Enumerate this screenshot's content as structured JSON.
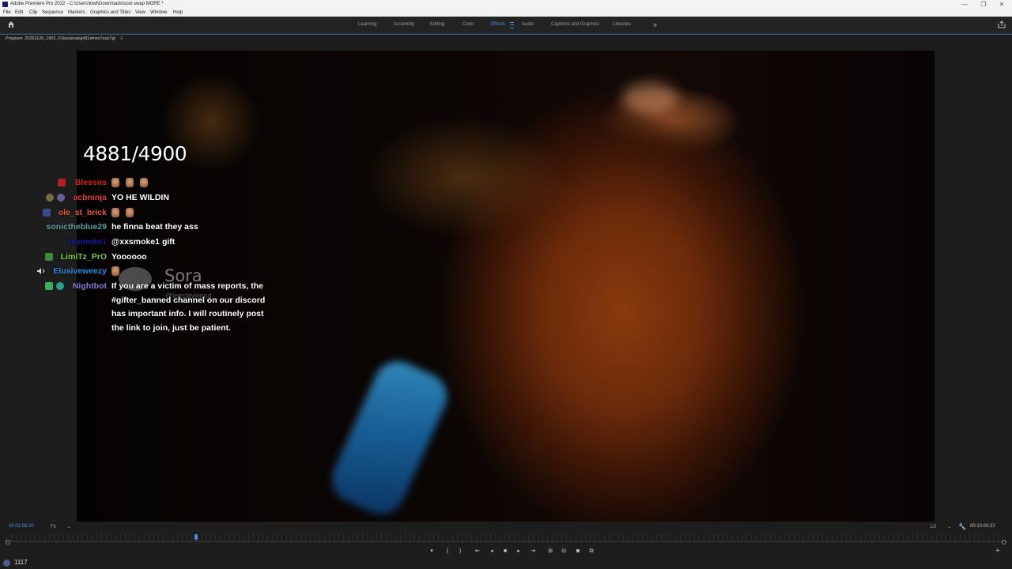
{
  "window": {
    "title": "Adobe Premiere Pro 2022 - C:\\Users\\lowt\\Downloads\\soul swap MORE *",
    "minimize": "—",
    "restore": "❐",
    "close": "✕"
  },
  "menu": [
    "File",
    "Edit",
    "Clip",
    "Sequence",
    "Markers",
    "Graphics and Titles",
    "View",
    "Window",
    "Help"
  ],
  "workspaces": {
    "tabs": [
      "Learning",
      "Assembly",
      "Editing",
      "Color",
      "Effects",
      "Audio",
      "Captions and Graphics",
      "Libraries"
    ],
    "active": "Effects",
    "more": "»"
  },
  "panel": {
    "title": "Program: 20251120_1902_01kacijoojeg481emsv7acp7gt",
    "menu_glyph": "≡"
  },
  "video": {
    "counter": "4881/4900",
    "watermark": {
      "brand": "Sora",
      "handle": "@leeclaywood"
    },
    "chat": [
      {
        "name": "Blessns",
        "color": "#d02020",
        "message": "",
        "emotes": 3,
        "badge_color": "#b02020"
      },
      {
        "name": "acbninja",
        "color": "#e04040",
        "message": "YO HE WILDIN",
        "emotes": 0,
        "badge_color": "#7a6a40"
      },
      {
        "name": "ole_st_brick",
        "color": "#e05a3a",
        "message": "",
        "emotes": 2,
        "badge_color": "#3a4a8a"
      },
      {
        "name": "sonictheblue29",
        "color": "#5f9ea0",
        "message": "he finna beat they ass",
        "emotes": 0,
        "badge_color": ""
      },
      {
        "name": "xxsmoke1",
        "color": "#1a1aa0",
        "message": "@xxsmoke1 gift",
        "emotes": 0,
        "badge_color": ""
      },
      {
        "name": "LimiTz_PrO",
        "color": "#7acc3a",
        "message": "Yoooooo",
        "emotes": 0,
        "badge_color": "#3a8a3a"
      },
      {
        "name": "Elusiveweezy",
        "color": "#2a8ae0",
        "message": "",
        "emotes": 0,
        "badge_color": "#dddddd"
      },
      {
        "name": "Nightbot",
        "color": "#8a7ae0",
        "message": "If you are a victim of mass reports, the #gifter_banned channel on our discord has important info. I will routinely post the link to join, just be patient.",
        "emotes": 0,
        "badge_color": "#3ab05a"
      }
    ]
  },
  "controls": {
    "timecode_current": "00:01:56:20",
    "fit": "Fit",
    "resolution": "1/2",
    "timecode_total": "00:10:03:21",
    "playhead_fraction": 0.19,
    "transport": [
      "marker",
      "in",
      "out",
      "go-to-in",
      "step-back",
      "stop",
      "step-forward",
      "go-to-out",
      "insert",
      "overwrite",
      "export-frame",
      "compare"
    ]
  },
  "status": {
    "count": "1117"
  },
  "colors": {
    "accent": "#4a90e2",
    "panel_bg": "#1d1d1d",
    "titlebar_bg": "#f3f3f3"
  }
}
